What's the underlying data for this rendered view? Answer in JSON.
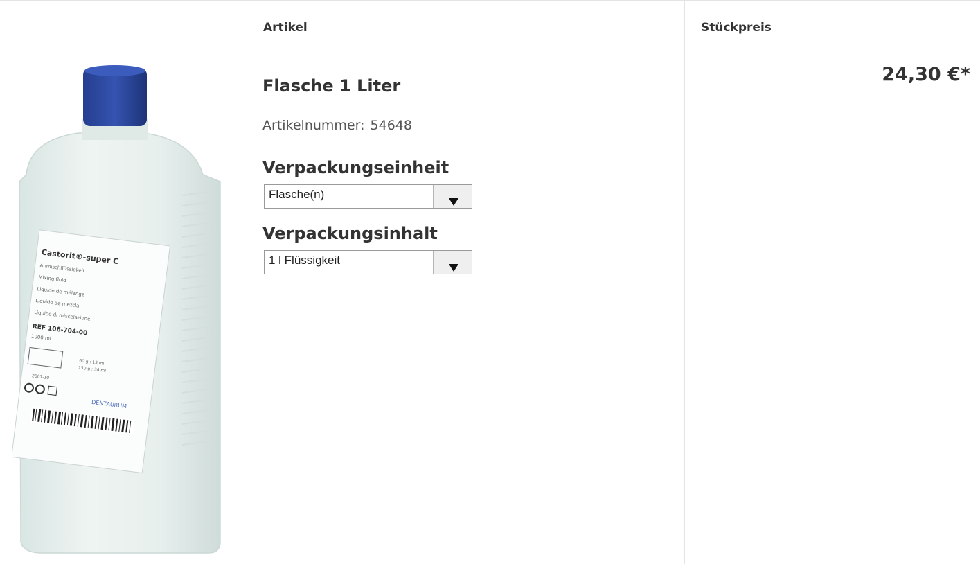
{
  "table": {
    "headers": {
      "article": "Artikel",
      "unit_price": "Stückpreis"
    }
  },
  "product": {
    "title": "Flasche 1 Liter",
    "article_number_label": "Artikelnummer:",
    "article_number": "54648",
    "packaging_unit": {
      "label": "Verpackungseinheit",
      "selected": "Flasche(n)"
    },
    "packaging_content": {
      "label": "Verpackungsinhalt",
      "selected": "1 l Flüssigkeit"
    },
    "price": "24,30 €*"
  },
  "bottle_label": {
    "brand": "Castorit®-super C",
    "lines": [
      "Anmischflüssigkeit",
      "Mixing fluid",
      "Liquide de mélange",
      "Liquido de mezcla",
      "Liquido di miscelazione"
    ],
    "ref": "REF 106-704-00",
    "volume": "1000 ml",
    "mix1": "60 g : 13 ml",
    "mix2": "150 g : 34 ml",
    "date": "2007-10",
    "maker": "DENTAURUM"
  },
  "colors": {
    "cap": "#2d4aa3",
    "bottle": "#e9f0ee",
    "border": "#e4e4e4"
  }
}
